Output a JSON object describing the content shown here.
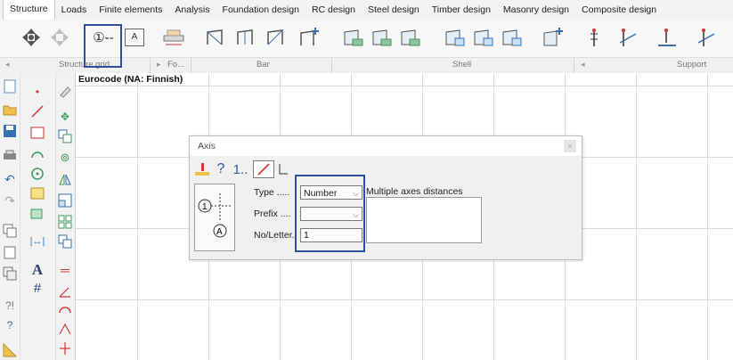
{
  "ribbon": {
    "tabs": [
      "Structure",
      "Loads",
      "Finite elements",
      "Analysis",
      "Foundation design",
      "RC design",
      "Steel design",
      "Timber design",
      "Masonry design",
      "Composite design"
    ],
    "groups": {
      "structure_grid": "Structure grid",
      "fo": "Fo...",
      "bar": "Bar",
      "shell": "Shell",
      "support": "Support"
    },
    "grid_button_text": "①--",
    "grid_button_letter": "A"
  },
  "canvas": {
    "code_label": "Eurocode (NA: Finnish)"
  },
  "left_toolbar": {
    "text_tool": "A",
    "hash_tool": "#"
  },
  "dialog": {
    "title": "Axis",
    "close": "×",
    "tool_help": "?",
    "tool_number": "1..",
    "type_label": "Type .....",
    "type_value": "Number",
    "prefix_label": "Prefix ....",
    "prefix_value": "",
    "noletter_label": "No/Letter.",
    "noletter_value": "1",
    "multiple_label": "Multiple axes distances"
  },
  "colors": {
    "highlight": "#2f4f99",
    "accent_red": "#d23a3a",
    "icon_blue": "#3a6fb0",
    "icon_green": "#3d9a5a"
  }
}
